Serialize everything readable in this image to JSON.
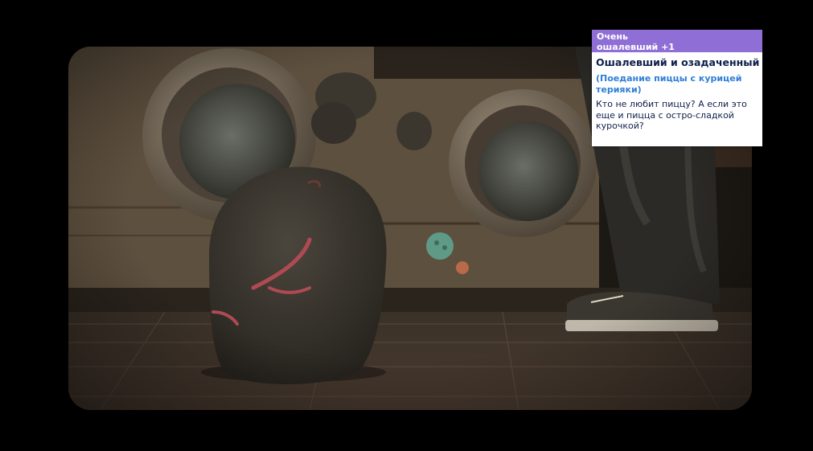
{
  "moodlet": {
    "intensity_label": "Очень",
    "emotion_label": "ошалевший +1",
    "title": "Ошалевший и озадаченный",
    "source": "(Поедание пиццы с курицей терияки)",
    "description": "Кто не любит пиццу? А если это еще и пицца с остро-сладкой курочкой?"
  },
  "colors": {
    "header_purple": "#8f6fd6",
    "title_navy": "#0f1f4a",
    "source_blue": "#2f7fd6"
  },
  "scene": {
    "subject": "laundry-room-floor-with-trash-pile-creature",
    "objects": [
      "washing-machine",
      "washing-machine",
      "trash-pile",
      "sim-legs",
      "sneaker"
    ]
  }
}
